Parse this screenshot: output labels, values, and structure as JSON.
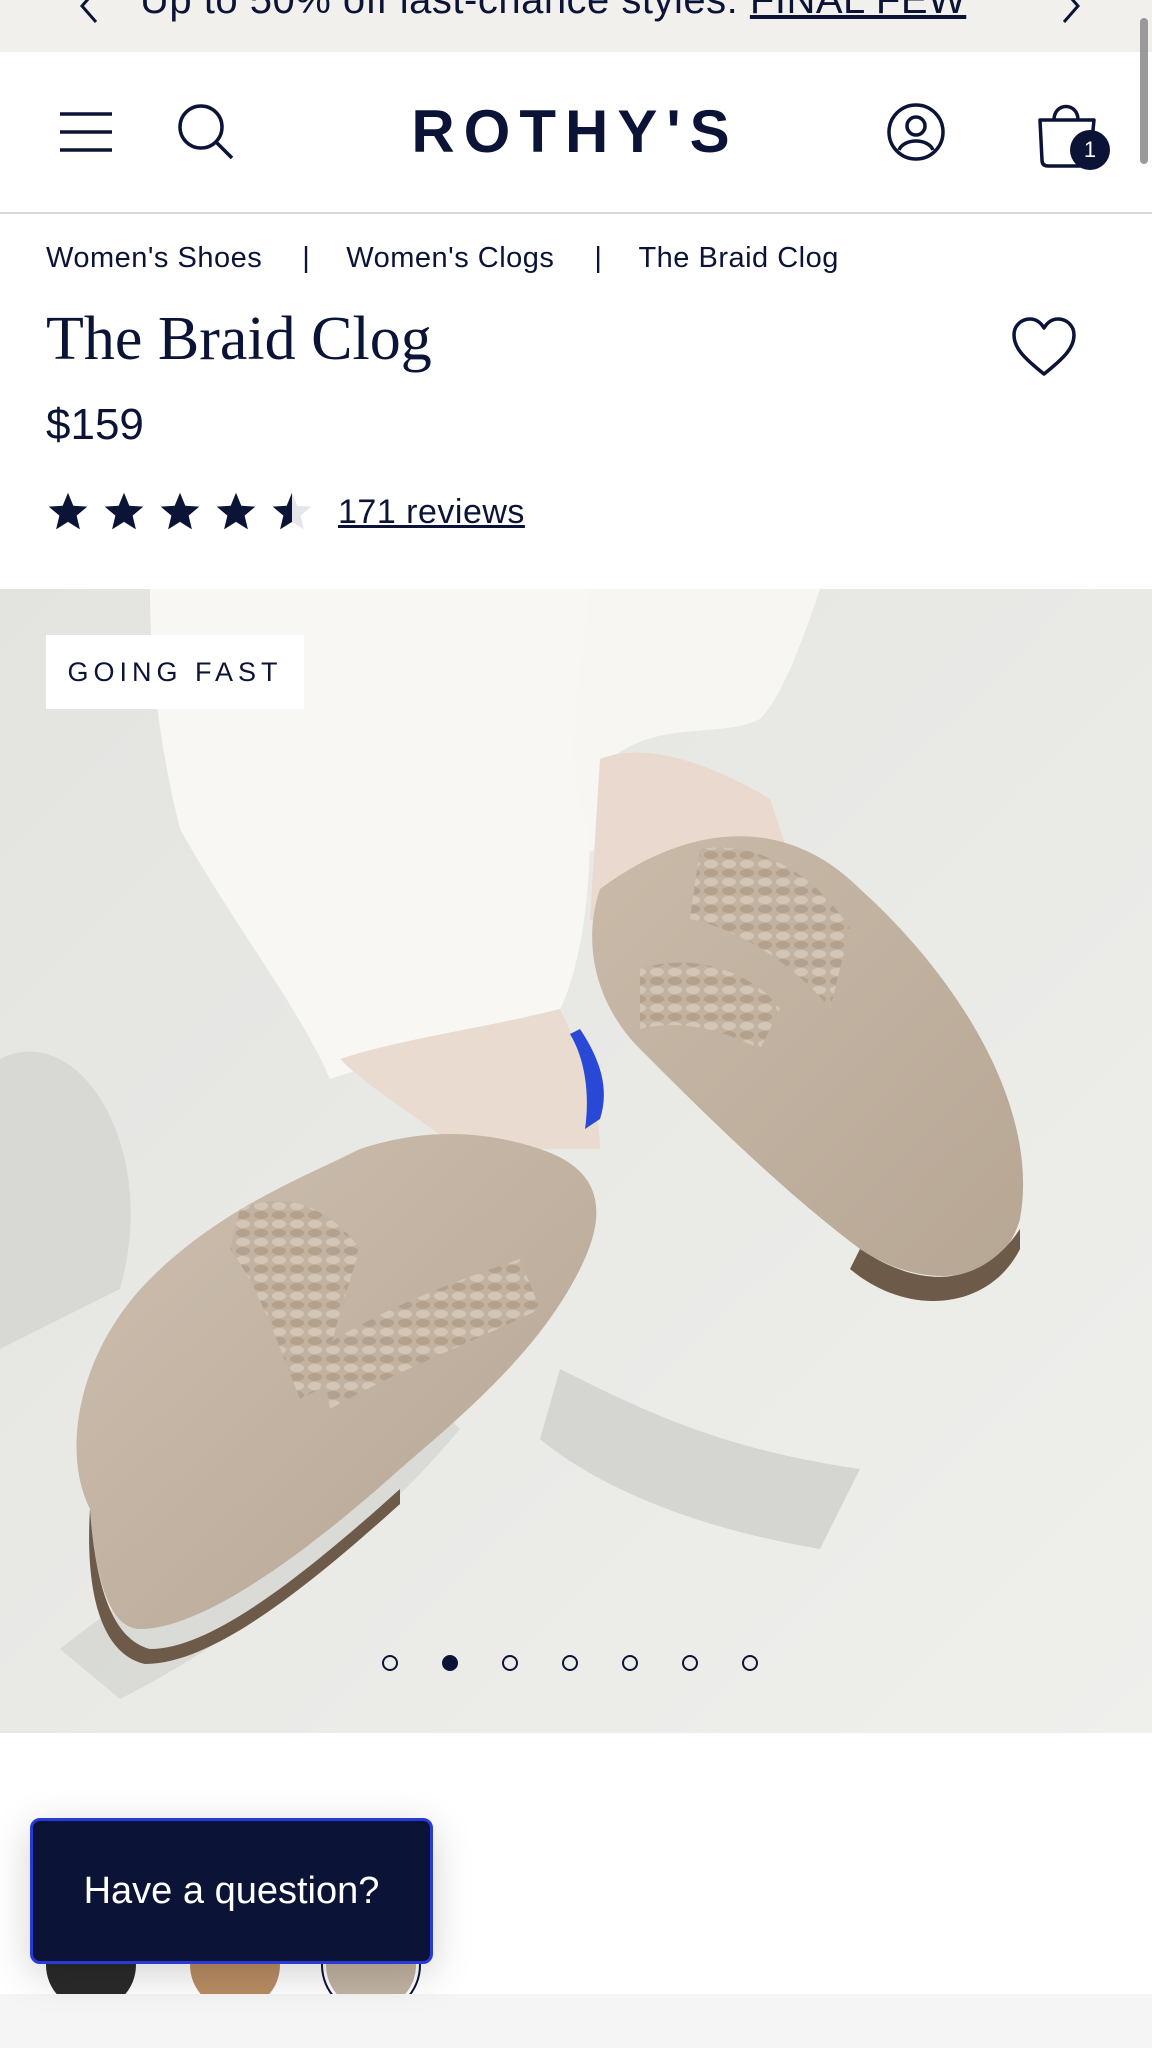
{
  "promo": {
    "text": "Up to 50% off last-chance styles: ",
    "link": "FINAL FEW"
  },
  "header": {
    "logo": "ROTHY'S",
    "cart_count": "1"
  },
  "breadcrumb": {
    "items": [
      "Women's Shoes",
      "Women's Clogs",
      "The Braid Clog"
    ],
    "separator": "|"
  },
  "product": {
    "title": "The Braid Clog",
    "price": "$159",
    "rating": 4.5,
    "reviews_label": "171 reviews",
    "badge": "GOING FAST"
  },
  "gallery": {
    "image_count": 7,
    "active_index": 1
  },
  "colors": {
    "primary": "#0b1437",
    "promo_bg": "#f2f0ed",
    "swatches": [
      "#2a2a2a",
      "#b98d64",
      "#c2b3a3"
    ]
  },
  "chat": {
    "label": "Have a question?"
  }
}
